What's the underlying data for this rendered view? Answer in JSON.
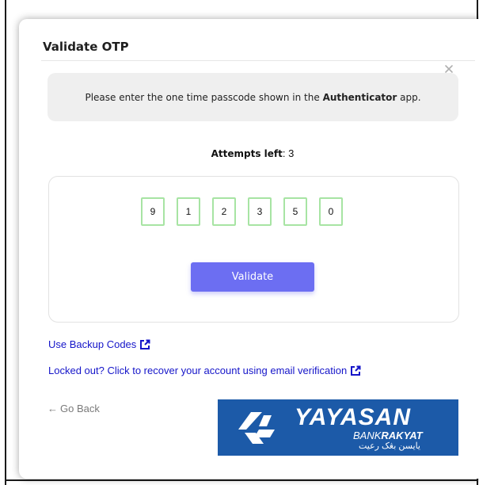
{
  "dialog": {
    "title": "Validate OTP",
    "close_icon": "close-icon"
  },
  "info": {
    "prefix": "Please enter the one time passcode shown in the ",
    "app_name": "Authenticator",
    "suffix": " app."
  },
  "attempts": {
    "label": "Attempts left",
    "separator": ":",
    "value": "3"
  },
  "otp": {
    "digits": [
      "9",
      "1",
      "2",
      "3",
      "5",
      "0"
    ]
  },
  "buttons": {
    "validate_label": "Validate"
  },
  "links": {
    "backup_codes": "Use Backup Codes",
    "recover_account": "Locked out? Click to recover your account using email verification",
    "external_icon": "external-link-icon"
  },
  "go_back": {
    "arrow": "←",
    "label": "Go Back"
  },
  "logo": {
    "main": "YAYASAN",
    "sub_prefix": "BANK",
    "sub_bold": "RAKYAT",
    "jawi": "يايسن بڠک رعيت"
  },
  "colors": {
    "accent": "#6c6ef2",
    "link": "#1515c9",
    "otp_border": "#a7e4a3",
    "logo_bg": "#1c5aa8"
  }
}
